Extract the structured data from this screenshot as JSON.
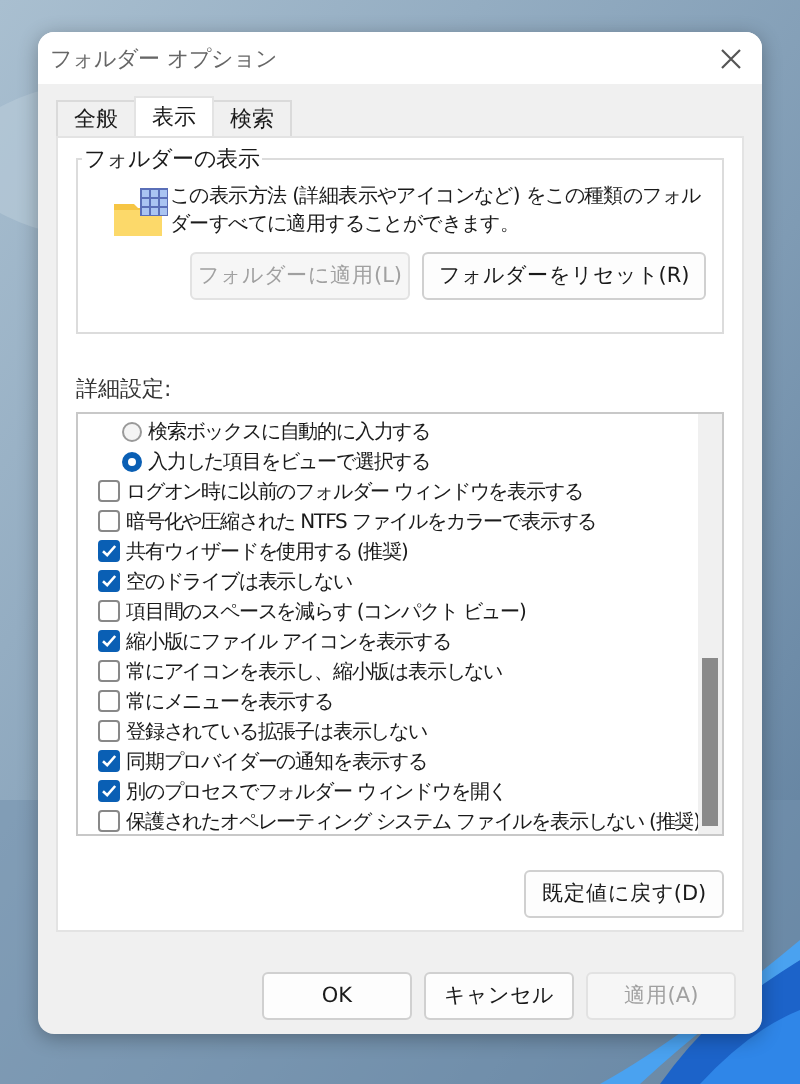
{
  "window": {
    "title": "フォルダー オプション"
  },
  "tabs": [
    {
      "label": "全般",
      "selected": false
    },
    {
      "label": "表示",
      "selected": true
    },
    {
      "label": "検索",
      "selected": false
    }
  ],
  "folder_views": {
    "title": "フォルダーの表示",
    "description": "この表示方法 (詳細表示やアイコンなど) をこの種類のフォルダーすべてに適用することができます。",
    "buttons": [
      {
        "label": "フォルダーに適用(L)",
        "disabled": true
      },
      {
        "label": "フォルダーをリセット(R)",
        "disabled": false
      }
    ]
  },
  "advanced": {
    "label": "詳細設定:",
    "items": [
      {
        "kind": "radio",
        "label": "検索ボックスに自動的に入力する",
        "selected": false
      },
      {
        "kind": "radio",
        "label": "入力した項目をビューで選択する",
        "selected": true
      },
      {
        "kind": "checkbox",
        "label": "ログオン時に以前のフォルダー ウィンドウを表示する",
        "checked": false
      },
      {
        "kind": "checkbox",
        "label": "暗号化や圧縮された NTFS ファイルをカラーで表示する",
        "checked": false
      },
      {
        "kind": "checkbox",
        "label": "共有ウィザードを使用する (推奨)",
        "checked": true
      },
      {
        "kind": "checkbox",
        "label": "空のドライブは表示しない",
        "checked": true
      },
      {
        "kind": "checkbox",
        "label": "項目間のスペースを減らす (コンパクト ビュー)",
        "checked": false
      },
      {
        "kind": "checkbox",
        "label": "縮小版にファイル アイコンを表示する",
        "checked": true
      },
      {
        "kind": "checkbox",
        "label": "常にアイコンを表示し、縮小版は表示しない",
        "checked": false
      },
      {
        "kind": "checkbox",
        "label": "常にメニューを表示する",
        "checked": false
      },
      {
        "kind": "checkbox",
        "label": "登録されている拡張子は表示しない",
        "checked": false
      },
      {
        "kind": "checkbox",
        "label": "同期プロバイダーの通知を表示する",
        "checked": true
      },
      {
        "kind": "checkbox",
        "label": "別のプロセスでフォルダー ウィンドウを開く",
        "checked": true
      },
      {
        "kind": "checkbox",
        "label": "保護されたオペレーティング システム ファイルを表示しない (推奨)",
        "checked": false
      }
    ],
    "restore_button": {
      "label": "既定値に戻す(D)"
    }
  },
  "buttons": [
    {
      "label": "OK",
      "disabled": false
    },
    {
      "label": "キャンセル",
      "disabled": false
    },
    {
      "label": "適用(A)",
      "disabled": true
    }
  ]
}
